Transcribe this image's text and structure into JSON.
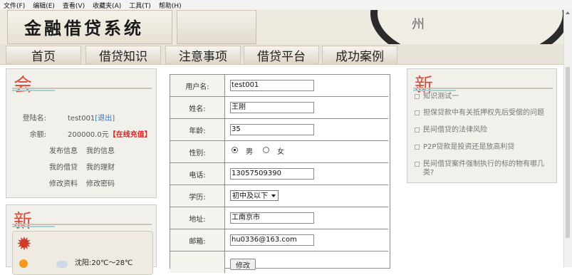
{
  "menubar": [
    "文件(F)",
    "编辑(E)",
    "查看(V)",
    "收藏夹(A)",
    "工具(T)",
    "帮助(H)"
  ],
  "banner": {
    "logo": "金融借贷系统",
    "city_char": "州"
  },
  "nav": [
    "首页",
    "借贷知识",
    "注意事项",
    "借贷平台",
    "成功案例"
  ],
  "user_panel": {
    "head_char": "会",
    "login_label": "登陆名:",
    "login_value": "test001",
    "logout": "[退出]",
    "balance_label": "余额:",
    "balance_value": "200000.0元",
    "recharge": "【在线充值】",
    "links": [
      "发布信息",
      "我的信息",
      "我的借贷",
      "我的理财",
      "修改资料",
      "修改密码"
    ]
  },
  "weather_panel": {
    "head_char": "新",
    "text": "沈阳:20℃～28℃"
  },
  "form": {
    "username_label": "用户名:",
    "username": "test001",
    "name_label": "姓名:",
    "name": "王刚",
    "age_label": "年龄:",
    "age": "35",
    "gender_label": "性别:",
    "male": "男",
    "female": "女",
    "phone_label": "电话:",
    "phone": "13057509390",
    "edu_label": "学历:",
    "edu": "初中及以下",
    "address_label": "地址:",
    "address": "工南京市",
    "email_label": "邮箱:",
    "email": "hu0336@163.com",
    "submit": "修改"
  },
  "news_panel": {
    "head_char": "新",
    "items": [
      "知识测试一",
      "担保贷款中有关抵押权先后受偿的问题",
      "民间借贷的法律风险",
      "P2P贷款是投资还是放高利贷",
      "民间借贷案件强制执行的标的物有哪几类?"
    ]
  },
  "colors": {
    "accent_red": "#d84b3b",
    "link_blue": "#3a73b7",
    "panel_bg": "#f2f0eb"
  }
}
